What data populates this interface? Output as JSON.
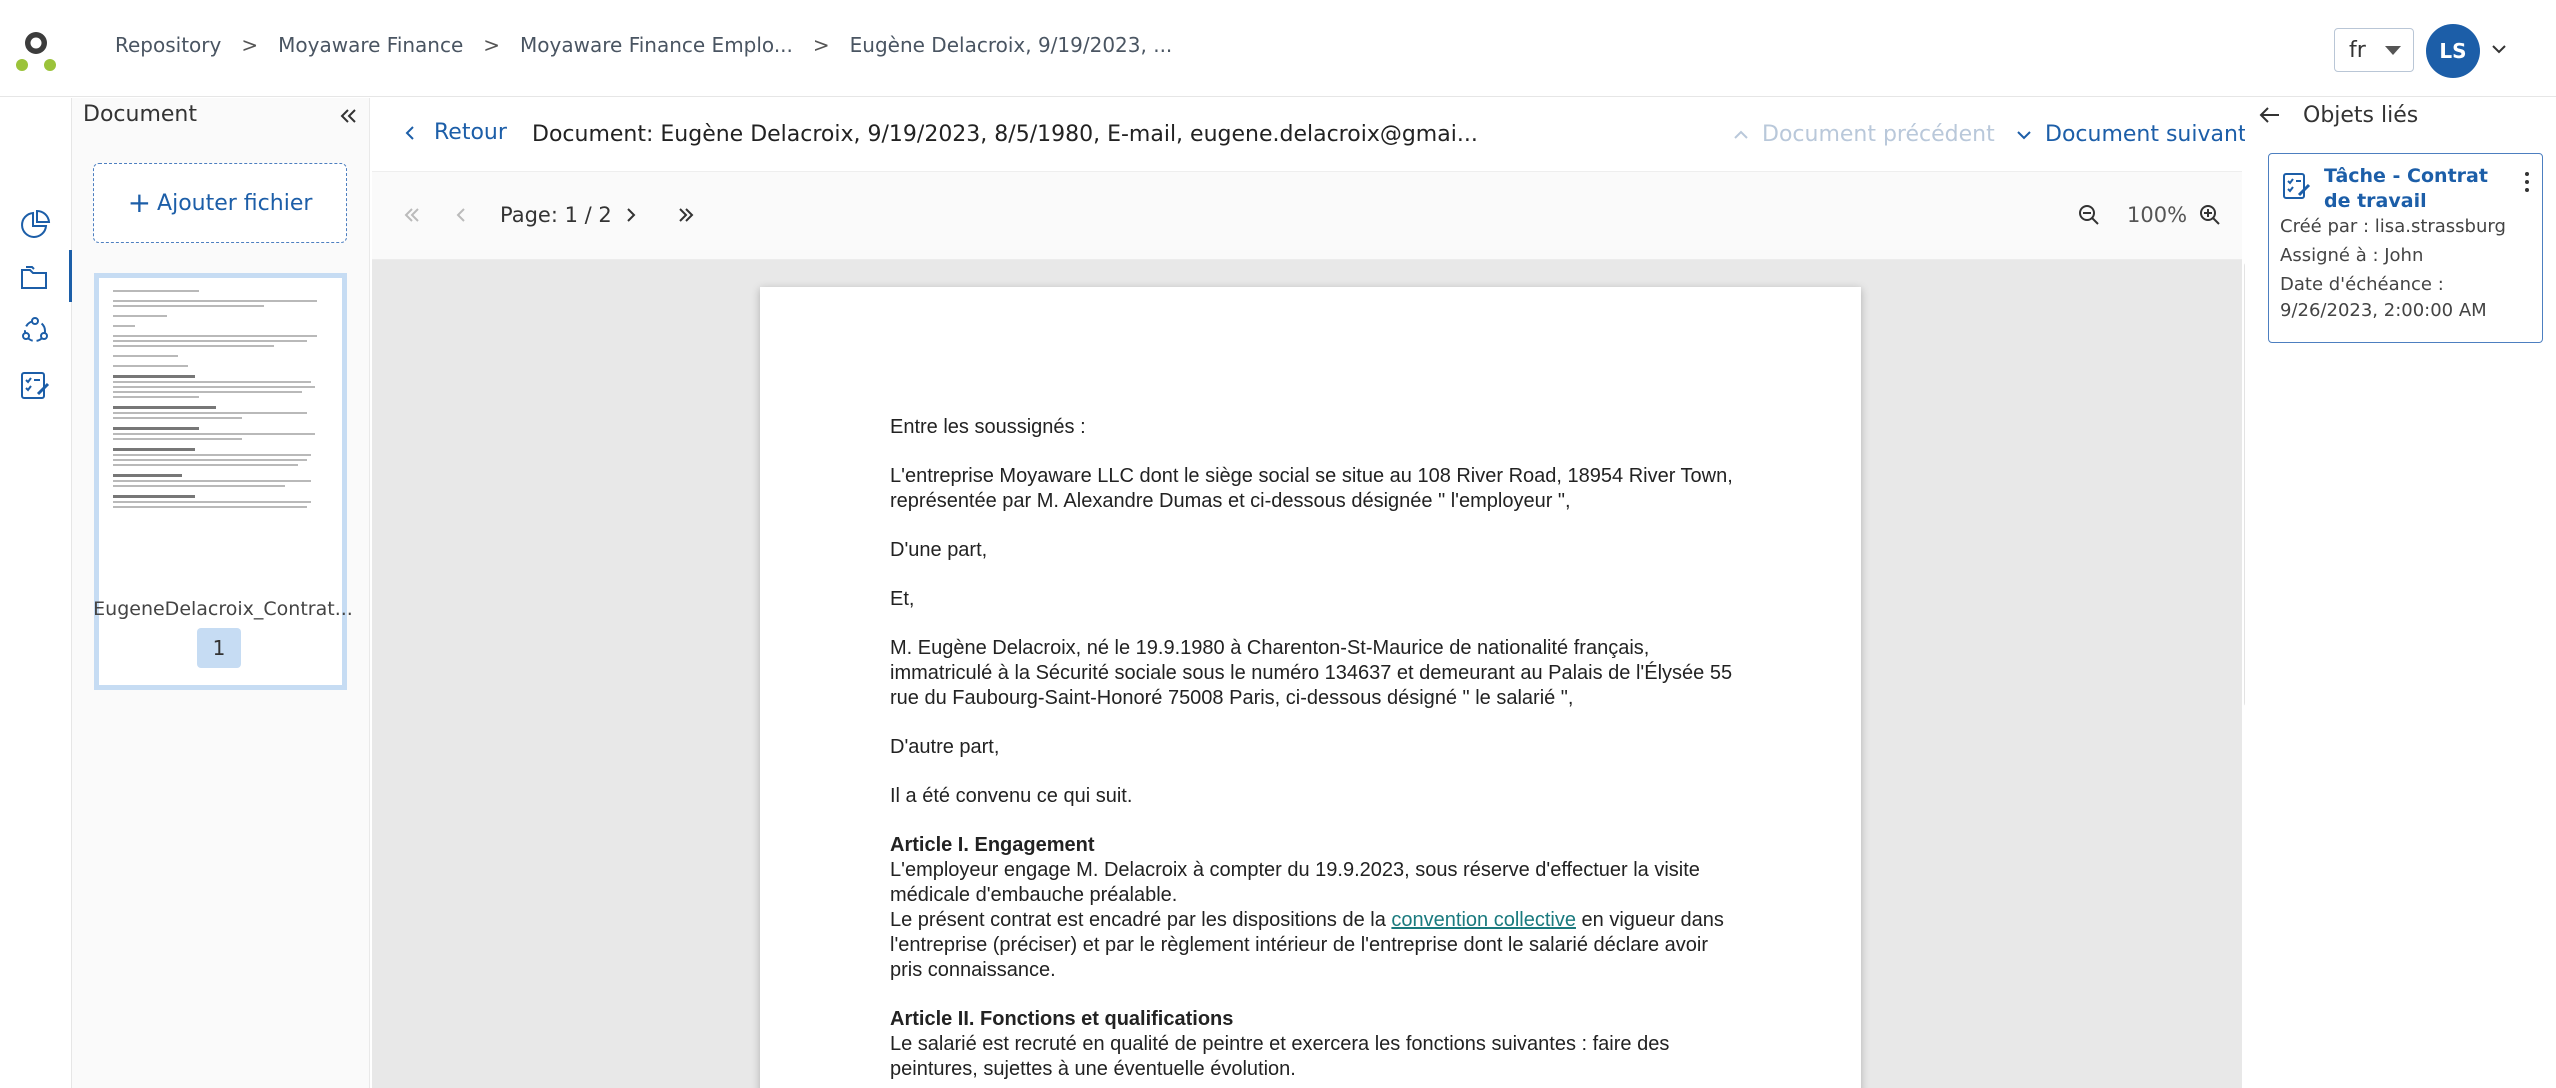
{
  "header": {
    "breadcrumbs": [
      "Repository",
      "Moyaware Finance",
      "Moyaware Finance Emplo...",
      "Eugène Delacroix, 9/19/2023, ..."
    ],
    "breadcrumb_separator": ">",
    "language": "fr",
    "user_initials": "LS"
  },
  "left_nav": {
    "items": [
      "dashboard-icon",
      "folder-icon",
      "workflow-icon",
      "tasks-icon"
    ]
  },
  "document_panel": {
    "title": "Document",
    "add_file_label": "Ajouter fichier",
    "add_file_icon": "+",
    "files": [
      {
        "name": "EugeneDelacroix_Contrat...",
        "page": "1"
      }
    ]
  },
  "viewer": {
    "back_label": "Retour",
    "title": "Document: Eugène Delacroix, 9/19/2023, 8/5/1980, E-mail, eugene.delacroix@gmai...",
    "prev_doc_label": "Document précédent",
    "next_doc_label": "Document suivant",
    "page_label": "Page: 1 / 2",
    "zoom": "100%"
  },
  "page_content": {
    "p1": "Entre les soussignés :",
    "p2": "L'entreprise Moyaware LLC dont le siège social se situe au 108 River Road, 18954 River Town, représentée par M. Alexandre Dumas et ci-dessous désignée \" l'employeur \",",
    "p3": "D'une part,",
    "p4": "Et,",
    "p5": "M. Eugène Delacroix, né le 19.9.1980 à Charenton-St-Maurice de nationalité français, immatriculé à la Sécurité sociale sous le numéro 134637 et demeurant au Palais de l'Élysée 55 rue du Faubourg-Saint-Honoré 75008 Paris, ci-dessous désigné \" le salarié \",",
    "p6": "D'autre part,",
    "p7": "Il a été convenu ce qui suit.",
    "art1_title": "Article I. Engagement",
    "art1_l1": "L'employeur engage M. Delacroix à compter du 19.9.2023, sous réserve d'effectuer la visite médicale d'embauche préalable.",
    "art1_l2a": "Le présent contrat est encadré par les dispositions de la ",
    "art1_link": "convention collective",
    "art1_l2b": " en vigueur dans l'entreprise (préciser) et par le règlement intérieur de l'entreprise dont le salarié déclare avoir pris connaissance.",
    "art2_title": "Article II. Fonctions et qualifications",
    "art2_l1": "Le salarié est recruté en qualité de peintre et exercera les fonctions suivantes : faire des peintures, sujettes à une éventuelle évolution."
  },
  "right_panel": {
    "title": "Objets liés",
    "task": {
      "title": "Tâche - Contrat de travail",
      "created_by": "Créé par : lisa.strassburg",
      "assigned_to": "Assigné à : John",
      "due_date": "Date d'échéance : 9/26/2023, 2:00:00 AM"
    }
  },
  "colors": {
    "accent": "#1c5ea8",
    "link": "#1a7a7e",
    "disabled": "#b9c8da",
    "logo_green": "#9bc33a",
    "logo_dark": "#3c3c3c"
  }
}
